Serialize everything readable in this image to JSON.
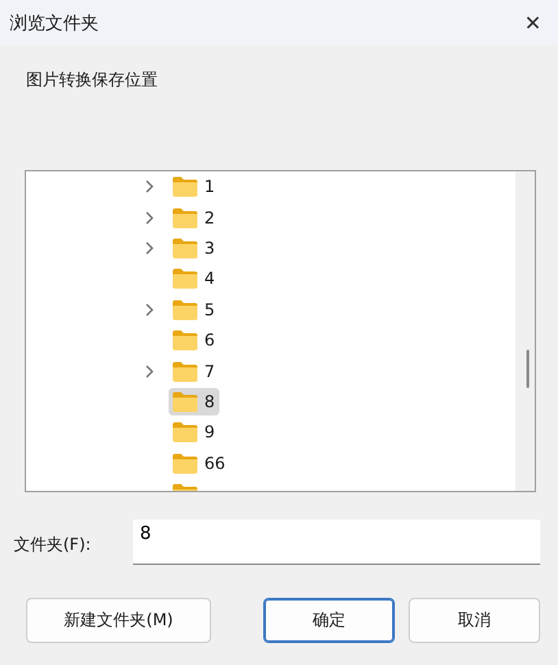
{
  "window": {
    "title": "浏览文件夹",
    "close": "✕"
  },
  "description": "图片转换保存位置",
  "tree": {
    "items": [
      {
        "label": "1",
        "expandable": true,
        "selected": false
      },
      {
        "label": "2",
        "expandable": true,
        "selected": false
      },
      {
        "label": "3",
        "expandable": true,
        "selected": false
      },
      {
        "label": "4",
        "expandable": false,
        "selected": false
      },
      {
        "label": "5",
        "expandable": true,
        "selected": false
      },
      {
        "label": "6",
        "expandable": false,
        "selected": false
      },
      {
        "label": "7",
        "expandable": true,
        "selected": false
      },
      {
        "label": "8",
        "expandable": false,
        "selected": true
      },
      {
        "label": "9",
        "expandable": false,
        "selected": false
      },
      {
        "label": "66",
        "expandable": false,
        "selected": false
      },
      {
        "expandable": false,
        "selected": false
      }
    ]
  },
  "folder_field": {
    "label": "文件夹(F):",
    "value": "8"
  },
  "buttons": [
    {
      "label": "新建文件夹(M)",
      "kind": "secondary"
    },
    {
      "label": "确定",
      "kind": "default"
    },
    {
      "label": "取消",
      "kind": "secondary"
    }
  ]
}
